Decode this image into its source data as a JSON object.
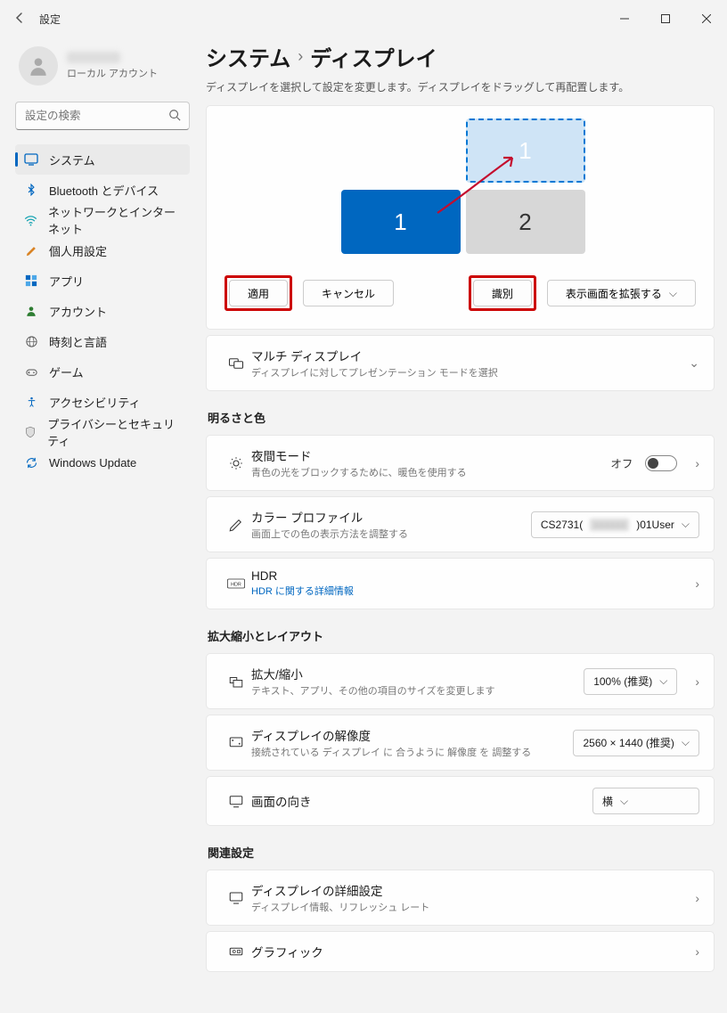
{
  "window": {
    "title": "設定"
  },
  "profile": {
    "account_type": "ローカル アカウント"
  },
  "search": {
    "placeholder": "設定の検索"
  },
  "sidebar": {
    "items": [
      {
        "label": "システム"
      },
      {
        "label": "Bluetooth とデバイス"
      },
      {
        "label": "ネットワークとインターネット"
      },
      {
        "label": "個人用設定"
      },
      {
        "label": "アプリ"
      },
      {
        "label": "アカウント"
      },
      {
        "label": "時刻と言語"
      },
      {
        "label": "ゲーム"
      },
      {
        "label": "アクセシビリティ"
      },
      {
        "label": "プライバシーとセキュリティ"
      },
      {
        "label": "Windows Update"
      }
    ]
  },
  "breadcrumb": {
    "root": "システム",
    "leaf": "ディスプレイ"
  },
  "main": {
    "desc": "ディスプレイを選択して設定を変更します。ディスプレイをドラッグして再配置します。",
    "monitor1": "1",
    "monitor2": "2",
    "monitor1ghost": "1",
    "apply": "適用",
    "cancel": "キャンセル",
    "identify": "識別",
    "extend": "表示画面を拡張する",
    "multi_title": "マルチ ディスプレイ",
    "multi_sub": "ディスプレイに対してプレゼンテーション モードを選択"
  },
  "brightness_section": "明るさと色",
  "night": {
    "title": "夜間モード",
    "sub": "青色の光をブロックするために、暖色を使用する",
    "state": "オフ"
  },
  "colorp": {
    "title": "カラー プロファイル",
    "sub": "画面上での色の表示方法を調整する",
    "value_prefix": "CS2731(",
    "value_suffix": ")01User"
  },
  "hdr": {
    "title": "HDR",
    "link": "HDR に関する詳細情報"
  },
  "scale_section": "拡大縮小とレイアウト",
  "scale": {
    "title": "拡大/縮小",
    "sub": "テキスト、アプリ、その他の項目のサイズを変更します",
    "value": "100% (推奨)"
  },
  "resolution": {
    "title": "ディスプレイの解像度",
    "sub": "接続されている ディスプレイ に 合うように 解像度 を 調整する",
    "value": "2560 × 1440 (推奨)"
  },
  "orientation": {
    "title": "画面の向き",
    "value": "横"
  },
  "related_section": "関連設定",
  "advdisp": {
    "title": "ディスプレイの詳細設定",
    "sub": "ディスプレイ情報、リフレッシュ レート"
  },
  "graphics": {
    "title": "グラフィック"
  }
}
